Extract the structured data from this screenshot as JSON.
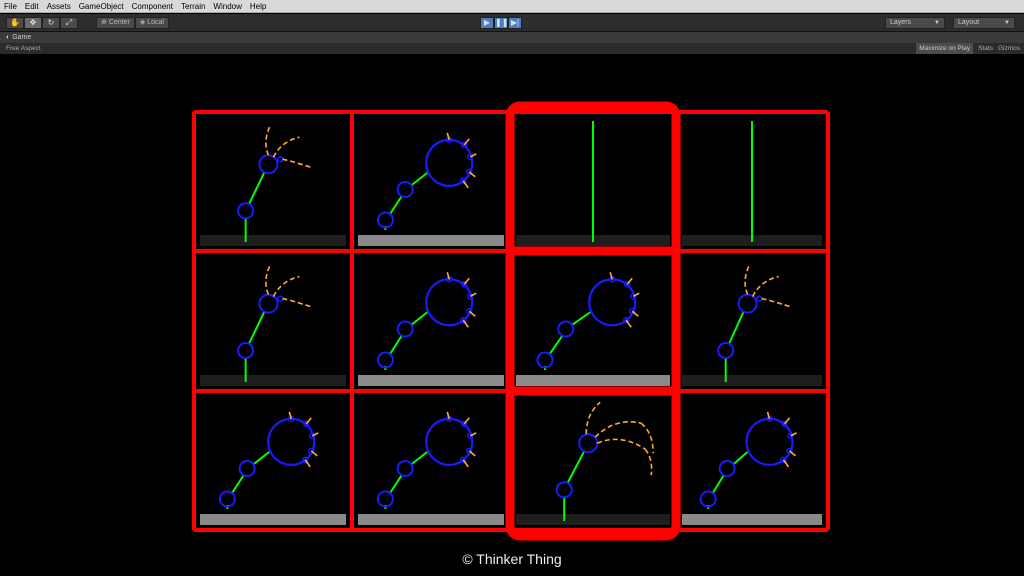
{
  "menu": [
    "File",
    "Edit",
    "Assets",
    "GameObject",
    "Component",
    "Terrain",
    "Window",
    "Help"
  ],
  "toolbar": {
    "tools": [
      "hand",
      "move",
      "rotate",
      "scale"
    ],
    "pivot_label": "Center",
    "space_label": "Local",
    "layers_label": "Layers",
    "layout_label": "Layout"
  },
  "panel": {
    "tab_label": "Game",
    "aspect_label": "Free Aspect",
    "maximize_label": "Maximize on Play",
    "stats_label": "Stats",
    "gizmos_label": "Gizmos"
  },
  "credit": "© Thinker Thing",
  "colors": {
    "border": "#ff0000",
    "stem": "#00ff00",
    "body": "#1a1aff",
    "limb": "#ffaa33",
    "ground": "#8a8a8a"
  },
  "grid": {
    "rows": 3,
    "cols": 4,
    "highlighted_column": 2,
    "cells": [
      {
        "type": "head_small",
        "ground": false
      },
      {
        "type": "big_ball",
        "ground": true
      },
      {
        "type": "stick",
        "ground": false
      },
      {
        "type": "stick",
        "ground": false
      },
      {
        "type": "head_small",
        "ground": false
      },
      {
        "type": "big_ball",
        "ground": true
      },
      {
        "type": "big_ball",
        "ground": true
      },
      {
        "type": "head_small",
        "ground": false
      },
      {
        "type": "big_ball",
        "ground": true
      },
      {
        "type": "big_ball",
        "ground": true
      },
      {
        "type": "head_curly",
        "ground": false
      },
      {
        "type": "big_ball",
        "ground": true
      }
    ]
  }
}
